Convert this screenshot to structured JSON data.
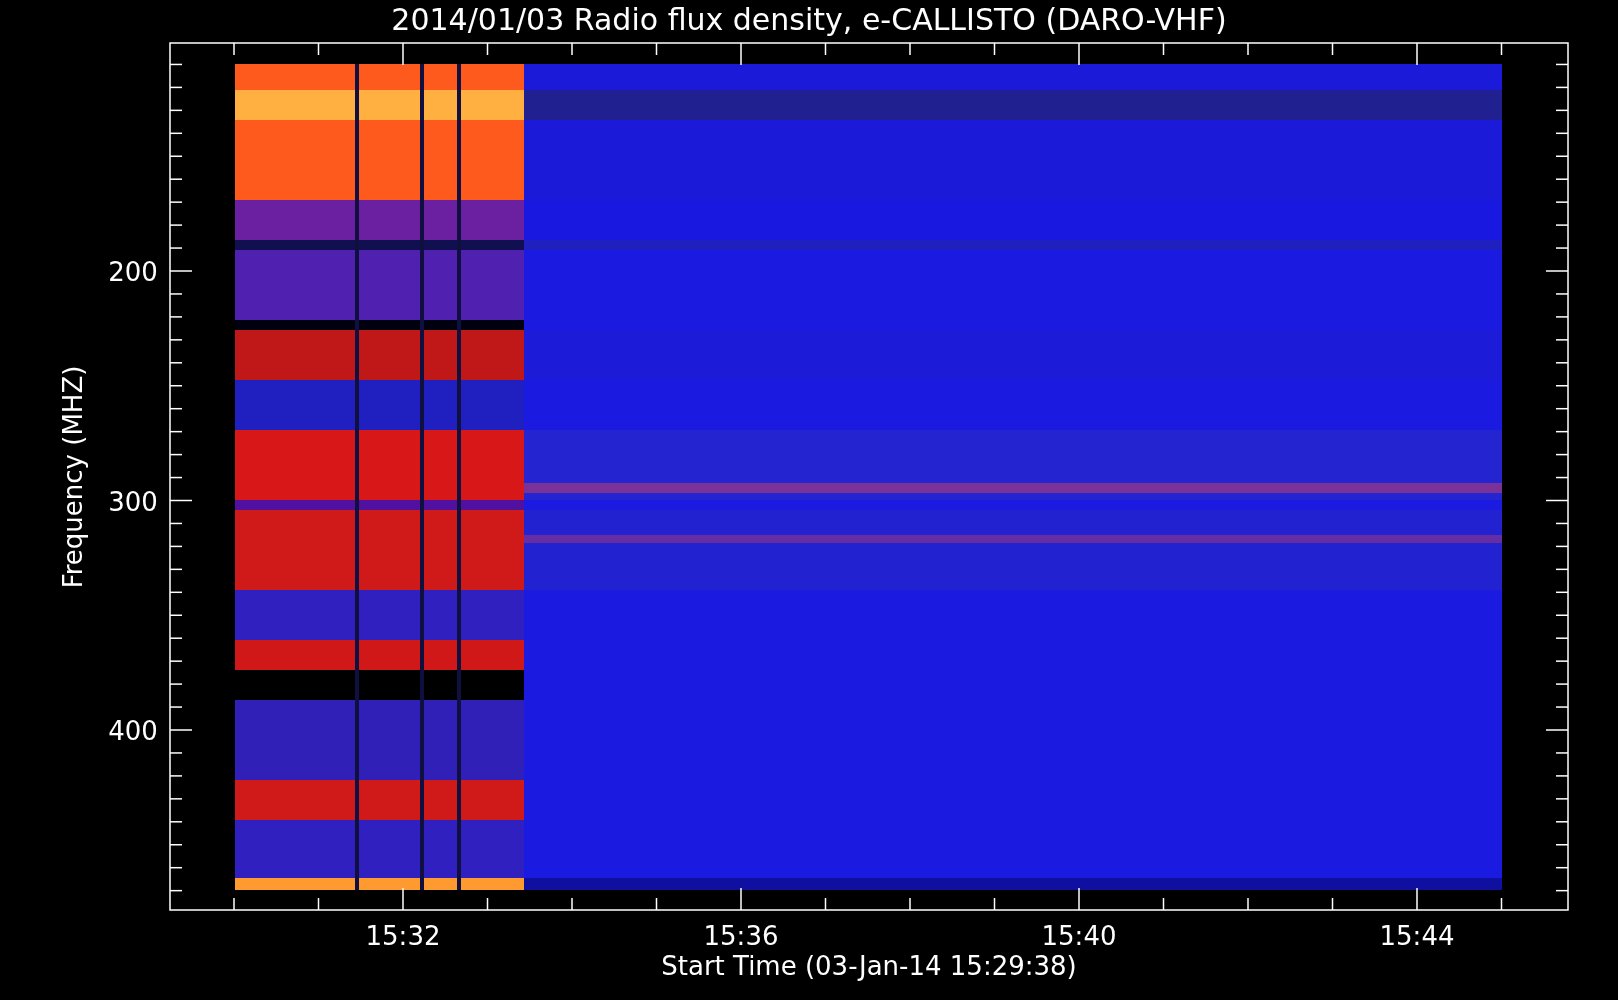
{
  "plot": {
    "title": "2014/01/03  Radio flux density, e-CALLISTO (DARO-VHF)",
    "y_axis": {
      "label": "Frequency (MHZ)",
      "ticks": [
        "200",
        "300",
        "400"
      ]
    },
    "x_axis": {
      "label": "Start Time (03-Jan-14 15:29:38)",
      "ticks": [
        "15:32",
        "15:36",
        "15:40",
        "15:44"
      ]
    }
  }
}
